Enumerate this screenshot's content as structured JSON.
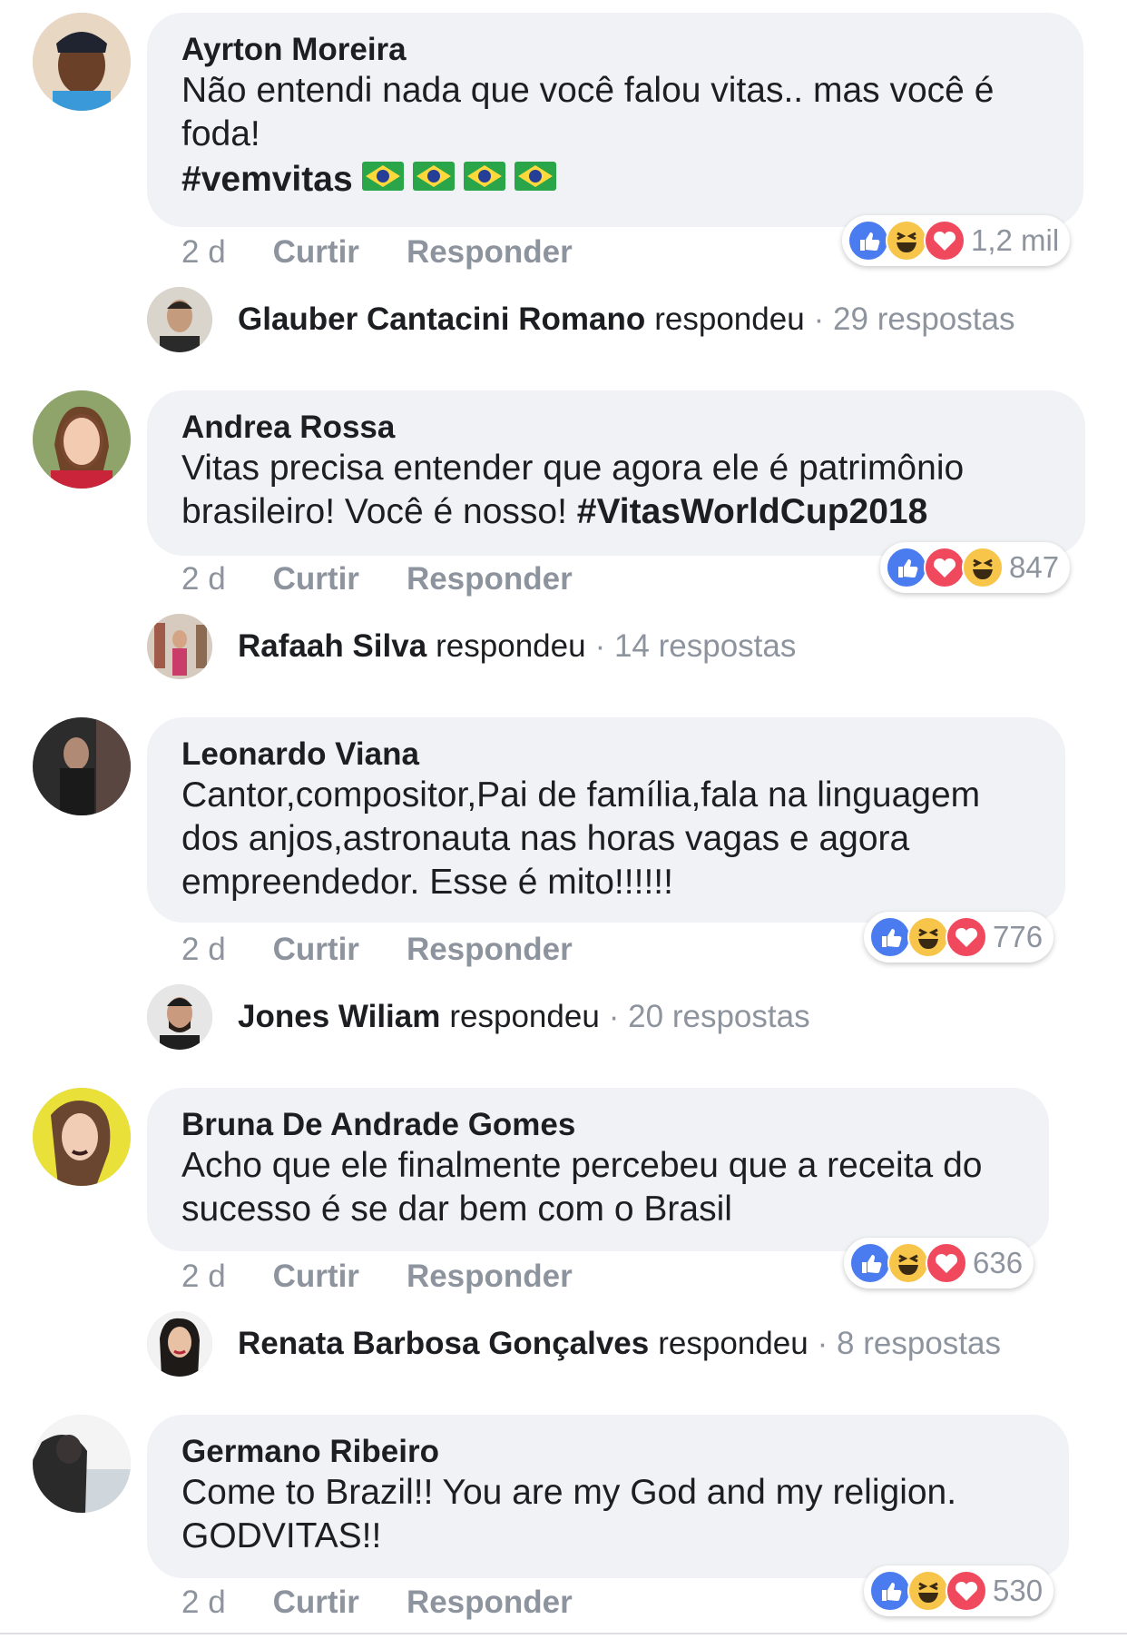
{
  "colors": {
    "like_blue": "#4a7cf0",
    "haha_yellow": "#f7c54a",
    "love_red": "#f0485c",
    "bubble_bg": "#f0f2f5",
    "meta_gray": "#8d949e"
  },
  "comments": [
    {
      "author": "Ayrton Moreira",
      "text": "Não entendi nada que você falou vitas.. mas você é foda!",
      "hashtag": "#vemvitas",
      "flags": [
        "brazil-flag-icon",
        "brazil-flag-icon",
        "brazil-flag-icon",
        "brazil-flag-icon"
      ],
      "time": "2 d",
      "like_label": "Curtir",
      "reply_label": "Responder",
      "reactions": [
        "like-icon",
        "haha-icon",
        "love-icon"
      ],
      "reaction_count": "1,2 mil",
      "reply_author": "Glauber Cantacini Romano",
      "reply_verb": "respondeu",
      "reply_count": "· 29 respostas"
    },
    {
      "author": "Andrea Rossa",
      "text": "Vitas precisa entender que agora ele é patrimônio brasileiro! Você é nosso!",
      "hashtag": "#VitasWorldCup2018",
      "time": "2 d",
      "like_label": "Curtir",
      "reply_label": "Responder",
      "reactions": [
        "like-icon",
        "love-icon",
        "haha-icon"
      ],
      "reaction_count": "847",
      "reply_author": "Rafaah Silva",
      "reply_verb": "respondeu",
      "reply_count": "· 14 respostas"
    },
    {
      "author": "Leonardo Viana",
      "text": "Cantor,compositor,Pai de família,fala na linguagem dos anjos,astronauta nas horas vagas e agora empreendedor. Esse é mito!!!!!!",
      "time": "2 d",
      "like_label": "Curtir",
      "reply_label": "Responder",
      "reactions": [
        "like-icon",
        "haha-icon",
        "love-icon"
      ],
      "reaction_count": "776",
      "reply_author": "Jones Wiliam",
      "reply_verb": "respondeu",
      "reply_count": "· 20 respostas"
    },
    {
      "author": "Bruna De Andrade Gomes",
      "text": "Acho que ele finalmente percebeu que a receita do sucesso é se dar bem com o Brasil",
      "time": "2 d",
      "like_label": "Curtir",
      "reply_label": "Responder",
      "reactions": [
        "like-icon",
        "haha-icon",
        "love-icon"
      ],
      "reaction_count": "636",
      "reply_author": "Renata Barbosa Gonçalves",
      "reply_verb": "respondeu",
      "reply_count": "· 8 respostas"
    },
    {
      "author": "Germano Ribeiro",
      "text": "Come to Brazil!! You are my God and my religion. GODVITAS!!",
      "time": "2 d",
      "like_label": "Curtir",
      "reply_label": "Responder",
      "reactions": [
        "like-icon",
        "haha-icon",
        "love-icon"
      ],
      "reaction_count": "530"
    }
  ]
}
